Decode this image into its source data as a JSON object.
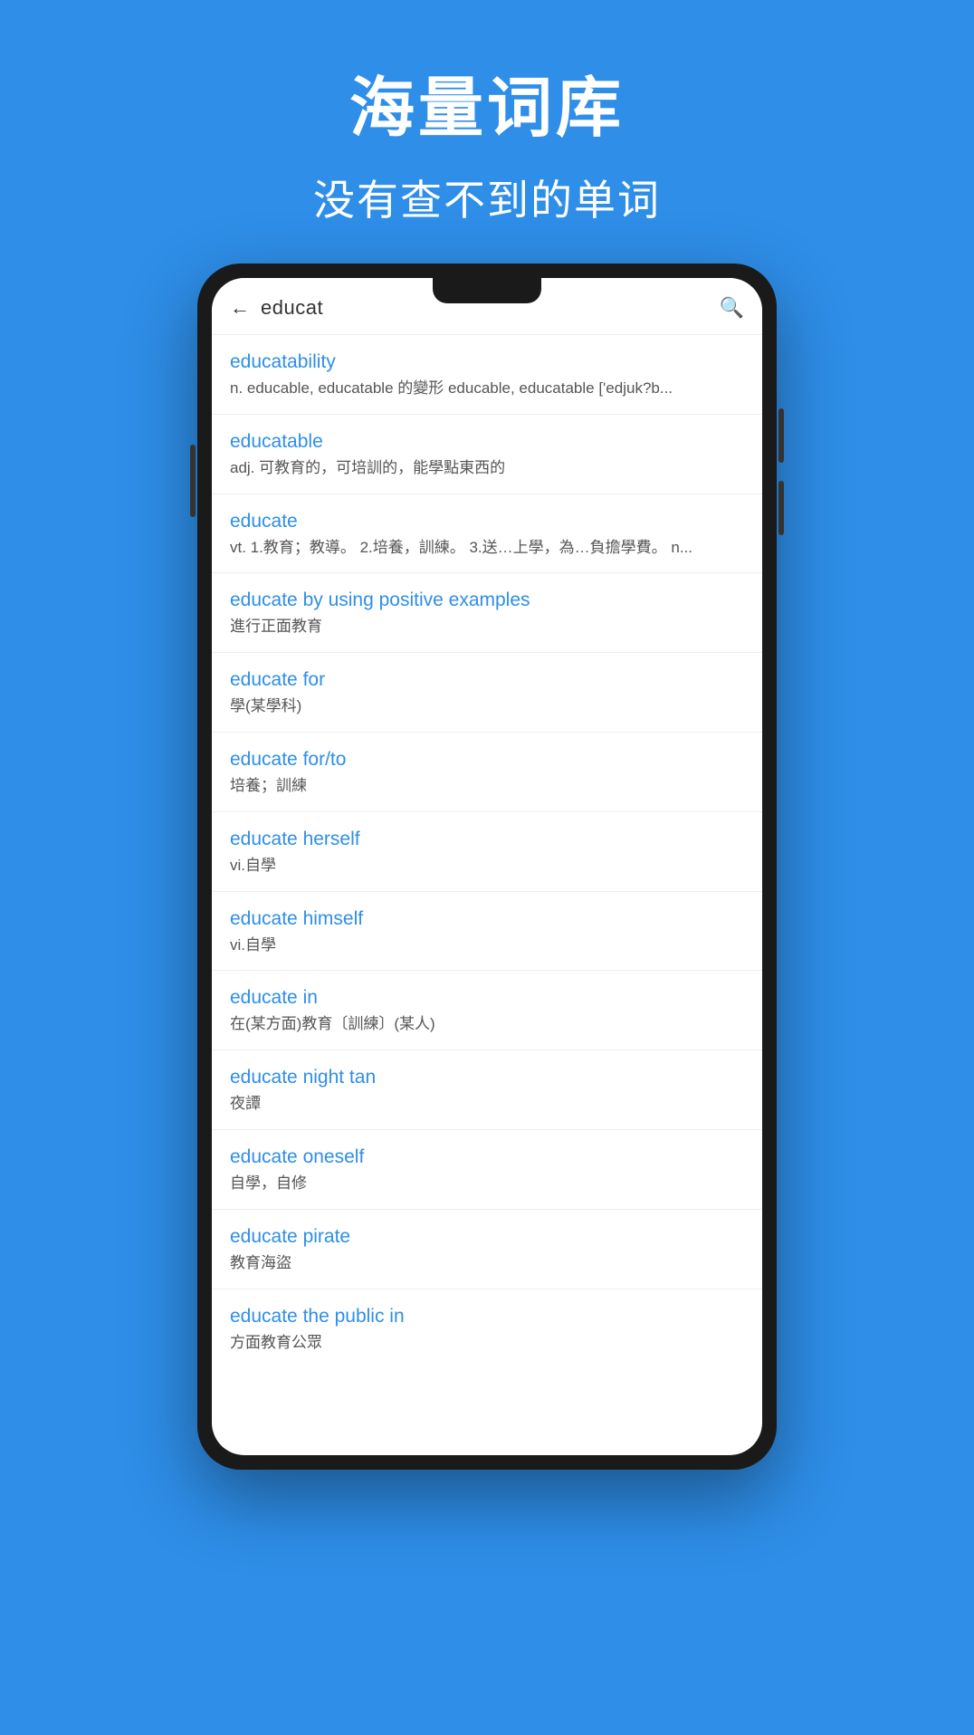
{
  "background_color": "#2E8EE8",
  "header": {
    "title": "海量词库",
    "subtitle": "没有查不到的单词"
  },
  "search": {
    "query": "educat",
    "back_label": "←",
    "search_icon_label": "🔍"
  },
  "results": [
    {
      "term": "educatability",
      "definition": "n.    educable, educatable 的變形    educable, educatable    ['edjuk?b..."
    },
    {
      "term": "educatable",
      "definition": "adj. 可教育的，可培訓的，能學點東西的"
    },
    {
      "term": "educate",
      "definition": "vt.  1.教育；教導。 2.培養，訓練。 3.送…上學，為…負擔學費。   n..."
    },
    {
      "term": "educate by using positive examples",
      "definition": "進行正面教育"
    },
    {
      "term": "educate for",
      "definition": "學(某學科)"
    },
    {
      "term": "educate for/to",
      "definition": "培養；訓練"
    },
    {
      "term": "educate herself",
      "definition": "vi.自學"
    },
    {
      "term": "educate himself",
      "definition": "vi.自學"
    },
    {
      "term": "educate in",
      "definition": "在(某方面)教育〔訓練〕(某人)"
    },
    {
      "term": "educate night tan",
      "definition": "夜譚"
    },
    {
      "term": "educate oneself",
      "definition": "自學，自修"
    },
    {
      "term": "educate pirate",
      "definition": "教育海盜"
    },
    {
      "term": "educate the public in",
      "definition": "方面教育公眾"
    }
  ]
}
